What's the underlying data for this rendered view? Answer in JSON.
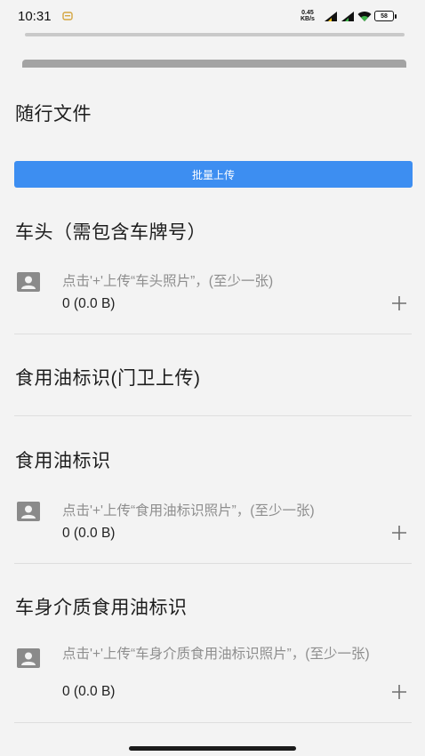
{
  "status_bar": {
    "time": "10:31",
    "net_speed_value": "0.45",
    "net_speed_unit": "KB/s",
    "battery_level": "58",
    "icons": [
      "notification-icon",
      "signal-icon",
      "signal-icon",
      "wifi-icon",
      "battery-icon"
    ]
  },
  "sections": {
    "attached_files": {
      "title": "随行文件"
    },
    "batch_upload": {
      "label": "批量上传"
    },
    "vehicle_head": {
      "title": "车头（需包含车牌号）",
      "hint": "点击'+'上传“车头照片”，(至少一张)",
      "size": "0 (0.0 B)"
    },
    "oil_mark_guard": {
      "title": "食用油标识(门卫上传)"
    },
    "oil_mark": {
      "title": "食用油标识",
      "hint": "点击'+'上传“食用油标识照片”，(至少一张)",
      "size": "0 (0.0 B)"
    },
    "body_oil_mark": {
      "title": "车身介质食用油标识",
      "hint": "点击'+'上传“车身介质食用油标识照片”，(至少一张)",
      "size": "0 (0.0 B)"
    }
  },
  "colors": {
    "accent": "#3d8ef1",
    "hint_text": "#8e8e8e",
    "background": "#f3f3f3"
  }
}
